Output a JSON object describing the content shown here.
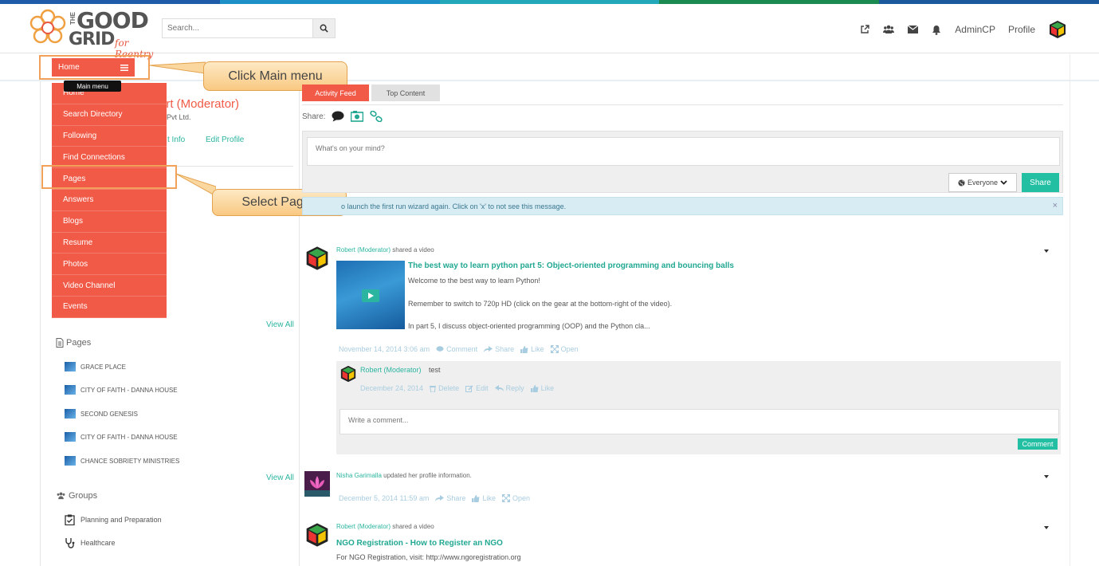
{
  "colors": {
    "accent": "#f05a47",
    "teal": "#22bfa3",
    "link": "#2bb5a0",
    "stripe1": "#1e5ba8",
    "stripe2": "#1e90c8",
    "stripe3": "#22a8b8",
    "stripe4": "#1a8a50",
    "stripe5": "#1a5a9c"
  },
  "logo": {
    "the": "THE",
    "good": "GOOD",
    "grid": "GRID",
    "tagline": "for Reentry"
  },
  "search": {
    "placeholder": "Search..."
  },
  "nav": {
    "icons": [
      "external-link-icon",
      "users-icon",
      "envelope-icon",
      "bell-icon"
    ],
    "admin": "AdminCP",
    "profile": "Profile"
  },
  "home_button": {
    "label": "Home"
  },
  "tooltip": "Main menu",
  "callouts": {
    "main_menu": "Click Main menu",
    "pages": "Select Pages"
  },
  "main_menu": {
    "items": [
      "Home",
      "Search Directory",
      "Following",
      "Find Connections",
      "Pages",
      "Answers",
      "Blogs",
      "Resume",
      "Photos",
      "Video Channel",
      "Events"
    ]
  },
  "profile": {
    "name_fragment": "ert (Moderator)",
    "org_fragment": "is Pvt Ltd.",
    "link1_fragment": "t Info",
    "link2": "Edit Profile"
  },
  "view_all": "View All",
  "pages_section": {
    "title": "Pages",
    "items": [
      "GRACE PLACE",
      "CITY OF FAITH - DANNA HOUSE",
      "SECOND GENESIS",
      "CITY OF FAITH - DANNA HOUSE",
      "CHANCE SOBRIETY MINISTRIES"
    ]
  },
  "groups_section": {
    "title": "Groups",
    "items": [
      "Planning and Preparation",
      "Healthcare"
    ]
  },
  "tabs": {
    "activity": "Activity Feed",
    "top": "Top Content"
  },
  "share": {
    "label": "Share:",
    "icons": [
      "speech-bubble-icon",
      "photo-icon",
      "link-icon"
    ]
  },
  "composer": {
    "placeholder": "What's on your mind?",
    "audience": "Everyone",
    "share_button": "Share"
  },
  "notice": {
    "text": "o launch the first run wizard again. Click on 'x' to not see this message.",
    "close": "×"
  },
  "post1": {
    "author": "Robert (Moderator)",
    "action": "shared a video",
    "title": "The best way to learn python part 5: Object-oriented programming and bouncing balls",
    "desc1": "Welcome to the best way to learn Python!",
    "desc2": "Remember to switch to 720p HD (click on the gear at the bottom-right of the video).",
    "desc3": "In part 5, I discuss object-oriented programming (OOP) and the Python cla...",
    "date": "November 14, 2014 3:06 am",
    "comment": "Comment",
    "share": "Share",
    "like": "Like",
    "open": "Open"
  },
  "comment1": {
    "author": "Robert (Moderator)",
    "text": "test",
    "date": "December 24, 2014",
    "delete": "Delete",
    "edit": "Edit",
    "reply": "Reply",
    "like": "Like"
  },
  "comment_input": {
    "placeholder": "Write a comment...",
    "button": "Comment"
  },
  "post2": {
    "author": "Nisha Garimalla",
    "action": "updated her profile information.",
    "date": "December 5, 2014 11:59 am",
    "share": "Share",
    "like": "Like",
    "open": "Open"
  },
  "post3": {
    "author": "Robert (Moderator)",
    "action": "shared a video",
    "title": "NGO Registration - How to Register an NGO",
    "desc": "For NGO Registration, visit: http://www.ngoregistration.org"
  }
}
